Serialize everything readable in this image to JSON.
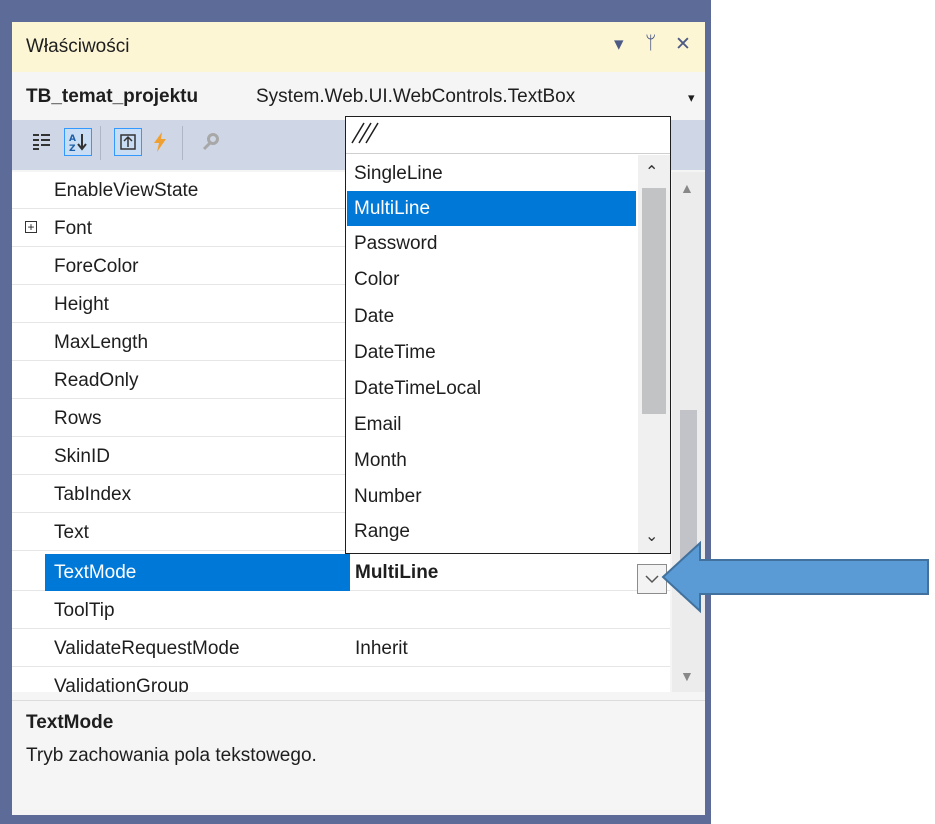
{
  "panel": {
    "title": "Właściwości",
    "buttons": {
      "dropdown": "▾",
      "pin": "ᛘ",
      "close": "✕"
    }
  },
  "object_selector": {
    "name": "TB_temat_projektu",
    "type": "System.Web.UI.WebControls.TextBox",
    "arrow": "▾"
  },
  "toolbar": {
    "icons": [
      "categorized-icon",
      "alphabetical-icon",
      "properties-icon",
      "events-icon",
      "property-pages-icon"
    ],
    "active": [
      "alphabetical-icon",
      "properties-icon"
    ]
  },
  "properties": [
    {
      "name": "EnableViewState",
      "value": ""
    },
    {
      "name": "Font",
      "value": "",
      "expandable": true,
      "expander": "+"
    },
    {
      "name": "ForeColor",
      "value": ""
    },
    {
      "name": "Height",
      "value": ""
    },
    {
      "name": "MaxLength",
      "value": ""
    },
    {
      "name": "ReadOnly",
      "value": ""
    },
    {
      "name": "Rows",
      "value": ""
    },
    {
      "name": "SkinID",
      "value": ""
    },
    {
      "name": "TabIndex",
      "value": ""
    },
    {
      "name": "Text",
      "value": ""
    },
    {
      "name": "TextMode",
      "value": "MultiLine",
      "selected": true
    },
    {
      "name": "ToolTip",
      "value": ""
    },
    {
      "name": "ValidateRequestMode",
      "value": "Inherit"
    },
    {
      "name": "ValidationGroup",
      "value": ""
    }
  ],
  "dropdown": {
    "options": [
      "SingleLine",
      "MultiLine",
      "Password",
      "Color",
      "Date",
      "DateTime",
      "DateTimeLocal",
      "Email",
      "Month",
      "Number",
      "Range"
    ],
    "selected": "MultiLine",
    "scroll_up": "⌃",
    "scroll_down": "⌄"
  },
  "description": {
    "title": "TextMode",
    "text": "Tryb zachowania pola tekstowego."
  },
  "colors": {
    "accent": "#0078d7",
    "frame": "#5d6b99",
    "callout_arrow": "#5b9bd5"
  }
}
